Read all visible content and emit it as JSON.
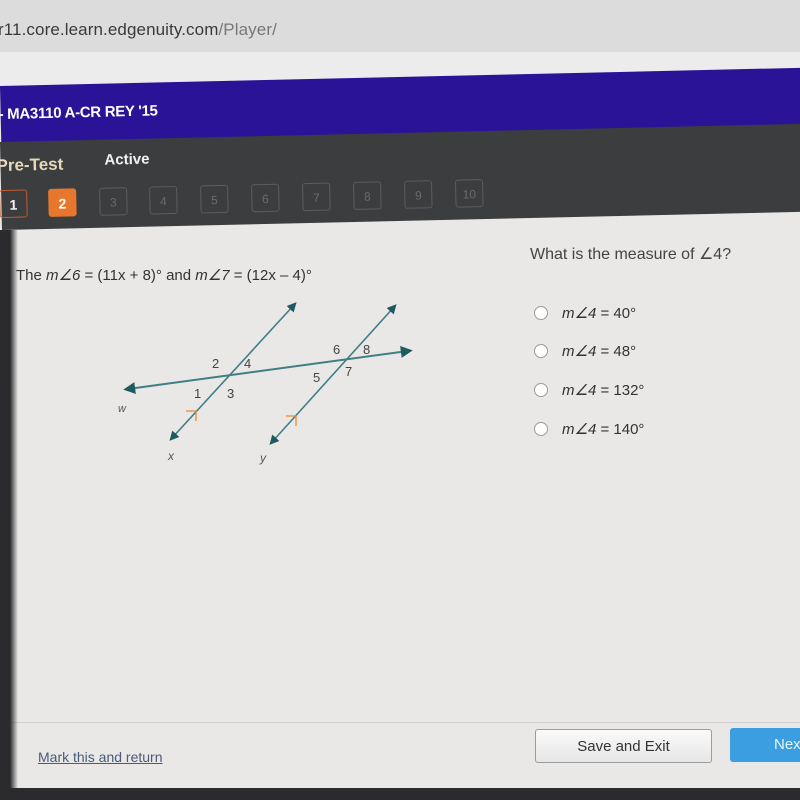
{
  "browser": {
    "url_host": "r11.core.learn.edgenuity.com",
    "url_path": "/Player/"
  },
  "course": {
    "title": "- MA3110 A-CR REY '15"
  },
  "test": {
    "label": "Pre-Test",
    "status": "Active",
    "questions": [
      {
        "label": "1",
        "state": "answered"
      },
      {
        "label": "2",
        "state": "current"
      },
      {
        "label": "3",
        "state": "locked"
      },
      {
        "label": "4",
        "state": "locked"
      },
      {
        "label": "5",
        "state": "locked"
      },
      {
        "label": "6",
        "state": "locked"
      },
      {
        "label": "7",
        "state": "locked"
      },
      {
        "label": "8",
        "state": "locked"
      },
      {
        "label": "9",
        "state": "locked"
      },
      {
        "label": "10",
        "state": "locked"
      }
    ]
  },
  "problem": {
    "prompt_prefix": "The ",
    "angle6": "m∠6",
    "angle6_expr": " = (11x + 8)° and ",
    "angle7": "m∠7",
    "angle7_expr": " = (12x – 4)°",
    "question": "What is the measure of ∠4?",
    "choices": [
      {
        "lhs": "m∠4",
        "rhs": " = 40°",
        "selected": false
      },
      {
        "lhs": "m∠4",
        "rhs": " = 48°",
        "selected": false
      },
      {
        "lhs": "m∠4",
        "rhs": " = 132°",
        "selected": false
      },
      {
        "lhs": "m∠4",
        "rhs": " = 140°",
        "selected": false
      }
    ]
  },
  "diagram": {
    "line_labels": {
      "transversal": "w",
      "left_parallel": "x",
      "right_parallel": "y"
    },
    "angle_labels": [
      "1",
      "2",
      "3",
      "4",
      "5",
      "6",
      "7",
      "8"
    ],
    "colors": {
      "line": "#3f7f84",
      "arrow": "#1f5a62",
      "parallel_mark": "#e8893a",
      "label": "#444444"
    }
  },
  "footer": {
    "mark_link": "Mark this and return",
    "save_exit": "Save and Exit",
    "next": "Next"
  },
  "colors": {
    "course_bar": "#2a1396",
    "test_bar": "#3c3d3f",
    "current_question": "#e8772e",
    "next_button": "#3b9ee0"
  }
}
